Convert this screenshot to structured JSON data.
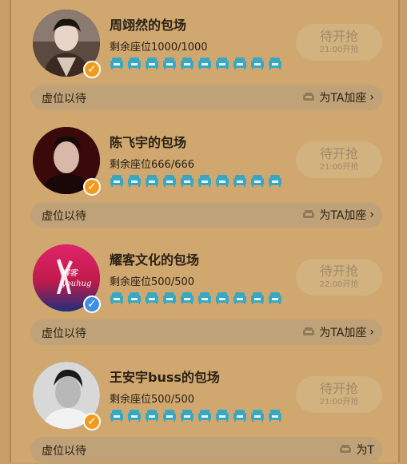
{
  "colors": {
    "page_bg": "#c89f67",
    "seat_teal": "#3aa7c2",
    "badge_orange": "#f29a1b",
    "badge_blue": "#3f8fe6",
    "button_text": "#9e8b6c"
  },
  "cards": [
    {
      "title": "周翊然的包场",
      "seats_text": "剩余座位1000/1000",
      "button_label": "待开抢",
      "button_time": "21:00开抢",
      "waitlist_label": "虚位以待",
      "add_seat_label": "为TA加座",
      "badge_icon": "check-badge-icon",
      "badge_color": "orange"
    },
    {
      "title": "陈飞宇的包场",
      "seats_text": "剩余座位666/666",
      "button_label": "待开抢",
      "button_time": "21:00开抢",
      "waitlist_label": "虚位以待",
      "add_seat_label": "为TA加座",
      "badge_icon": "check-badge-icon",
      "badge_color": "orange"
    },
    {
      "title": "耀客文化的包场",
      "seats_text": "剩余座位500/500",
      "button_label": "待开抢",
      "button_time": "22:00开抢",
      "waitlist_label": "虚位以待",
      "add_seat_label": "为TA加座",
      "badge_icon": "check-badge-icon",
      "badge_color": "blue",
      "logo_text": "耀客 youhug"
    },
    {
      "title": "王安宇buss的包场",
      "seats_text": "剩余座位500/500",
      "button_label": "待开抢",
      "button_time": "21:00开抢",
      "waitlist_label": "虚位以待",
      "add_seat_label": "为T",
      "badge_icon": "check-badge-icon",
      "badge_color": "orange"
    }
  ],
  "seat_icons_per_card": 10,
  "icons": {
    "seat": "sofa-seat-icon",
    "add_seat": "sofa-icon",
    "chevron": "chevron-right-icon"
  }
}
